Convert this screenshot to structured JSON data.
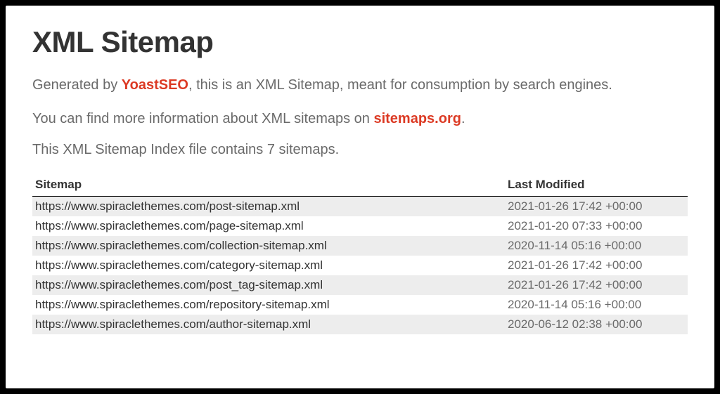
{
  "title": "XML Sitemap",
  "intro": {
    "prefix": "Generated by ",
    "link1_text": "YoastSEO",
    "mid": ", this is an XML Sitemap, meant for consumption by search engines.",
    "line2_prefix": "You can find more information about XML sitemaps on ",
    "link2_text": "sitemaps.org",
    "line2_suffix": "."
  },
  "summary": "This XML Sitemap Index file contains 7 sitemaps.",
  "table": {
    "headers": {
      "sitemap": "Sitemap",
      "last_modified": "Last Modified"
    },
    "rows": [
      {
        "url": "https://www.spiraclethemes.com/post-sitemap.xml",
        "date": "2021-01-26 17:42 +00:00"
      },
      {
        "url": "https://www.spiraclethemes.com/page-sitemap.xml",
        "date": "2021-01-20 07:33 +00:00"
      },
      {
        "url": "https://www.spiraclethemes.com/collection-sitemap.xml",
        "date": "2020-11-14 05:16 +00:00"
      },
      {
        "url": "https://www.spiraclethemes.com/category-sitemap.xml",
        "date": "2021-01-26 17:42 +00:00"
      },
      {
        "url": "https://www.spiraclethemes.com/post_tag-sitemap.xml",
        "date": "2021-01-26 17:42 +00:00"
      },
      {
        "url": "https://www.spiraclethemes.com/repository-sitemap.xml",
        "date": "2020-11-14 05:16 +00:00"
      },
      {
        "url": "https://www.spiraclethemes.com/author-sitemap.xml",
        "date": "2020-06-12 02:38 +00:00"
      }
    ]
  }
}
